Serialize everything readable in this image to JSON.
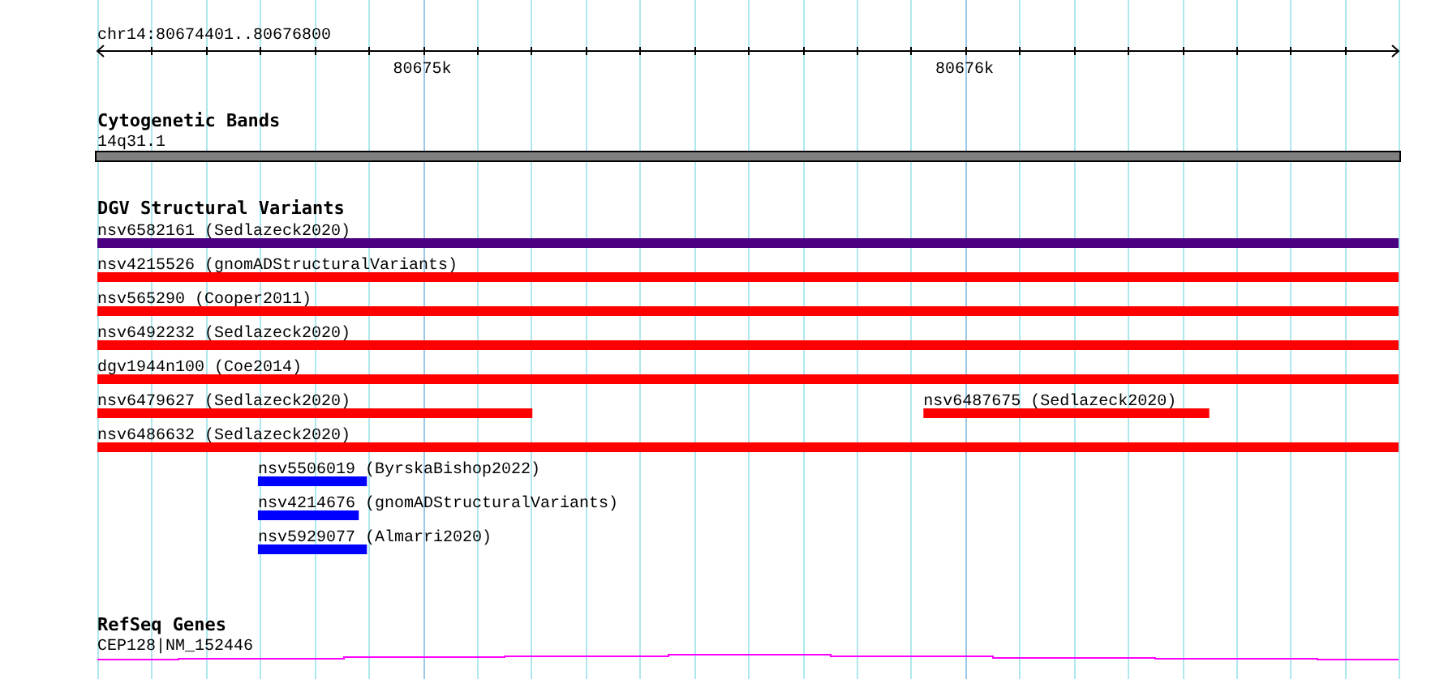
{
  "ruler": {
    "label": "chr14:80674401..80676800",
    "ticks": [
      {
        "label": "80675k"
      },
      {
        "label": "80676k"
      }
    ]
  },
  "cytogenetic_bands": {
    "title": "Cytogenetic Bands",
    "band": {
      "label": "14q31.1"
    }
  },
  "dgv_structural_variants": {
    "title": "DGV Structural Variants",
    "rows": [
      {
        "features": [
          {
            "label": "nsv6582161 (Sedlazeck2020)",
            "color": "#4b0082"
          }
        ]
      },
      {
        "features": [
          {
            "label": "nsv4215526 (gnomADStructuralVariants)",
            "color": "#ff0000"
          }
        ]
      },
      {
        "features": [
          {
            "label": "nsv565290 (Cooper2011)",
            "color": "#ff0000"
          }
        ]
      },
      {
        "features": [
          {
            "label": "nsv6492232 (Sedlazeck2020)",
            "color": "#ff0000"
          }
        ]
      },
      {
        "features": [
          {
            "label": "dgv1944n100 (Coe2014)",
            "color": "#ff0000"
          }
        ]
      },
      {
        "features": [
          {
            "label": "nsv6479627 (Sedlazeck2020)",
            "color": "#ff0000"
          },
          {
            "label": "nsv6487675 (Sedlazeck2020)",
            "color": "#ff0000"
          }
        ]
      },
      {
        "features": [
          {
            "label": "nsv6486632 (Sedlazeck2020)",
            "color": "#ff0000"
          }
        ]
      },
      {
        "features": [
          {
            "label": "nsv5506019 (ByrskaBishop2022)",
            "color": "#0000ff"
          }
        ]
      },
      {
        "features": [
          {
            "label": "nsv4214676 (gnomADStructuralVariants)",
            "color": "#0000ff"
          }
        ]
      },
      {
        "features": [
          {
            "label": "nsv5929077 (Almarri2020)",
            "color": "#0000ff"
          }
        ]
      }
    ]
  },
  "refseq_genes": {
    "title": "RefSeq Genes",
    "genes": [
      {
        "label": "CEP128|NM_152446"
      }
    ]
  }
}
